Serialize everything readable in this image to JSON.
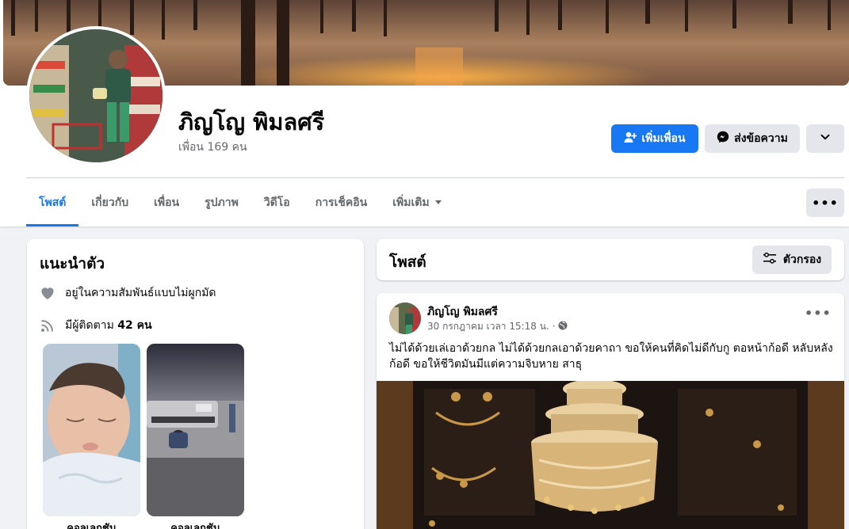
{
  "profile": {
    "name": "ภิญโญ พิมลศรี",
    "friends": "เพื่อน 169 คน"
  },
  "actions": {
    "add_friend": "เพิ่มเพื่อน",
    "message": "ส่งข้อความ"
  },
  "tabs": [
    {
      "label": "โพสต์",
      "active": true
    },
    {
      "label": "เกี่ยวกับ"
    },
    {
      "label": "เพื่อน"
    },
    {
      "label": "รูปภาพ"
    },
    {
      "label": "วิดีโอ"
    },
    {
      "label": "การเช็คอิน"
    },
    {
      "label": "เพิ่มเติม"
    }
  ],
  "intro": {
    "title": "แนะนำตัว",
    "relationship": "อยู่ในความสัมพันธ์แบบไม่ผูกมัด",
    "followers_prefix": "มีผู้ติดตาม ",
    "followers_count": "42 คน",
    "featured": [
      {
        "label": "คอลเลกชัน"
      },
      {
        "label": "คอลเลกชัน"
      }
    ]
  },
  "posts": {
    "title": "โพสต์",
    "filter_label": "ตัวกรอง"
  },
  "post": {
    "author": "ภิญโญ พิมลศรี",
    "time": "30 กรกฎาคม เวลา 15:18 น. ·",
    "text": "ไม่ได้ด้วยเล่เอาด้วยกล ไม่ได้ด้วยกลเอาด้วยคาถา  ขอให้คนที่คิดไม่ดีกับกู ตอหน้าก้อดี หลับหลังก้อดี ขอให้ชีวิตมันมีแต่ความจิบหาย  สาธุ"
  },
  "colors": {
    "accent": "#1877f2",
    "secondary_button": "#e4e6eb",
    "background": "#f0f2f5",
    "muted_text": "#65676b"
  },
  "icons": [
    "add-friend-icon",
    "messenger-icon",
    "chevron-down-icon",
    "more-dots-icon",
    "heart-icon",
    "rss-icon",
    "filter-icon",
    "globe-icon"
  ]
}
